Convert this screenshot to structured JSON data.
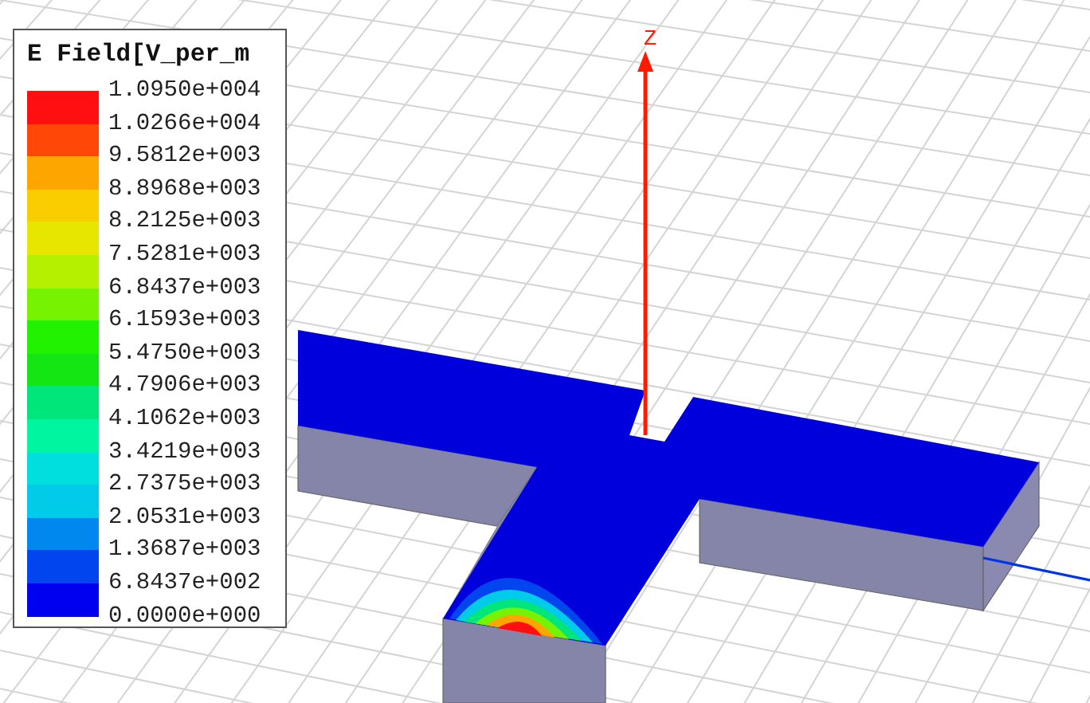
{
  "legend": {
    "title": "E Field[V_per_m",
    "labels": [
      "1.0950e+004",
      "1.0266e+004",
      "9.5812e+003",
      "8.8968e+003",
      "8.2125e+003",
      "7.5281e+003",
      "6.8437e+003",
      "6.1593e+003",
      "5.4750e+003",
      "4.7906e+003",
      "4.1062e+003",
      "3.4219e+003",
      "2.7375e+003",
      "2.0531e+003",
      "1.3687e+003",
      "6.8437e+002",
      "0.0000e+000"
    ],
    "bands": [
      {
        "color": "#ff0f0f"
      },
      {
        "color": "#ff4808"
      },
      {
        "color": "#ffa500"
      },
      {
        "color": "#f9cd00"
      },
      {
        "color": "#e6e600"
      },
      {
        "color": "#b5f000"
      },
      {
        "color": "#77f200"
      },
      {
        "color": "#21f200"
      },
      {
        "color": "#14e614"
      },
      {
        "color": "#00e67a"
      },
      {
        "color": "#00f5a0"
      },
      {
        "color": "#00dedd"
      },
      {
        "color": "#00ccea"
      },
      {
        "color": "#0088ee"
      },
      {
        "color": "#0045ee"
      },
      {
        "color": "#0000f0"
      }
    ]
  },
  "axes": {
    "z_label": "Z"
  }
}
